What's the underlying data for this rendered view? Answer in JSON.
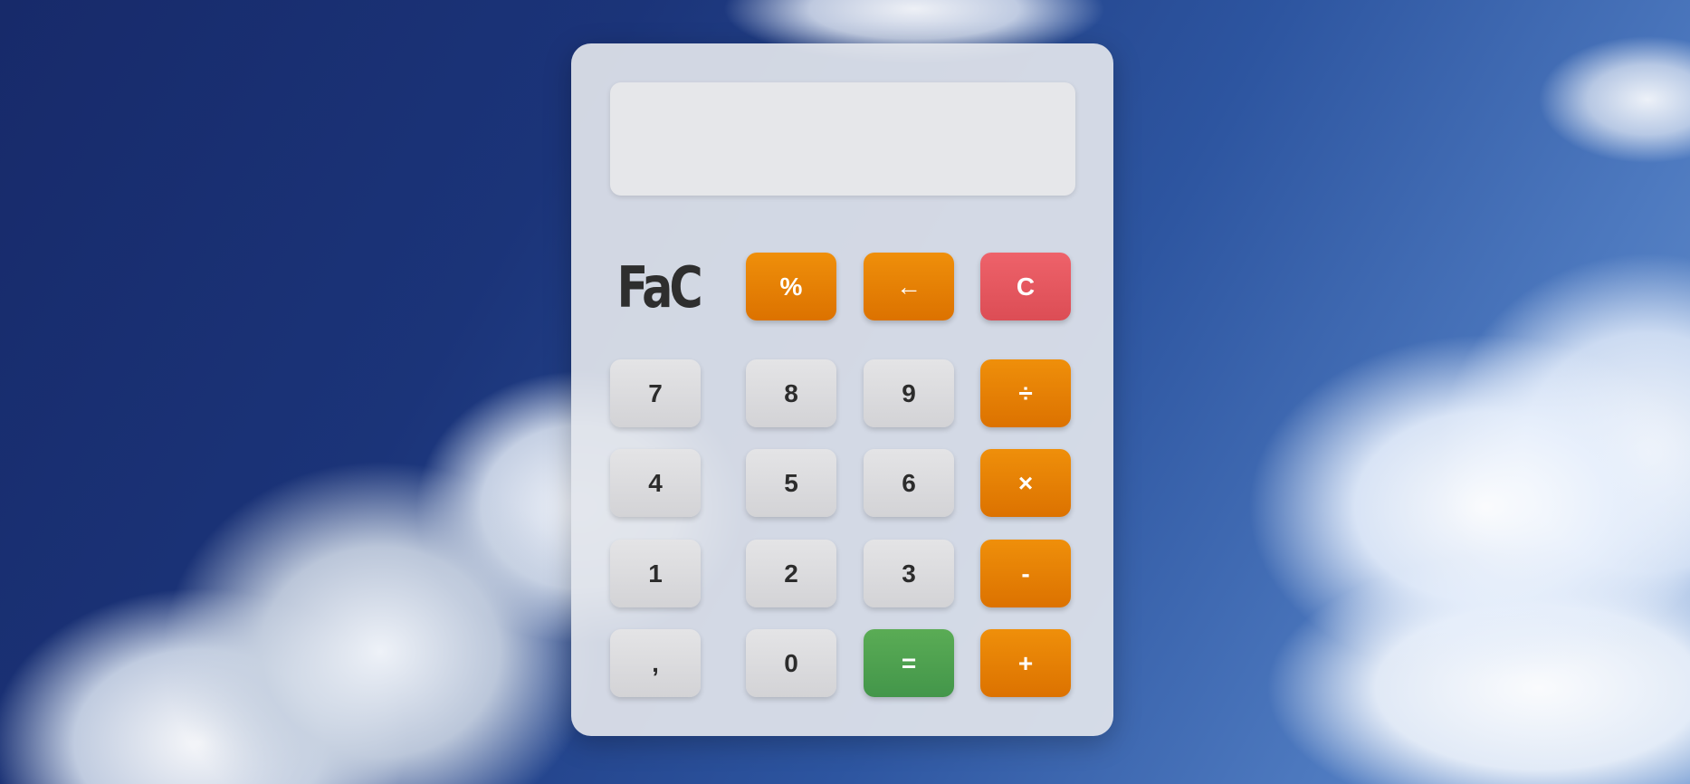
{
  "calculator": {
    "display_value": "",
    "brand": "FaC",
    "keys": {
      "percent": "%",
      "backspace": "←",
      "clear": "C",
      "seven": "7",
      "eight": "8",
      "nine": "9",
      "divide": "÷",
      "four": "4",
      "five": "5",
      "six": "6",
      "multiply": "×",
      "one": "1",
      "two": "2",
      "three": "3",
      "subtract": "-",
      "decimal": ",",
      "zero": "0",
      "equals": "=",
      "add": "+"
    }
  },
  "colors": {
    "operator": "#e67f00",
    "clear": "#e5555e",
    "equals": "#4ea04f",
    "number": "#dcdcdf",
    "panel": "#e2e5ec"
  }
}
